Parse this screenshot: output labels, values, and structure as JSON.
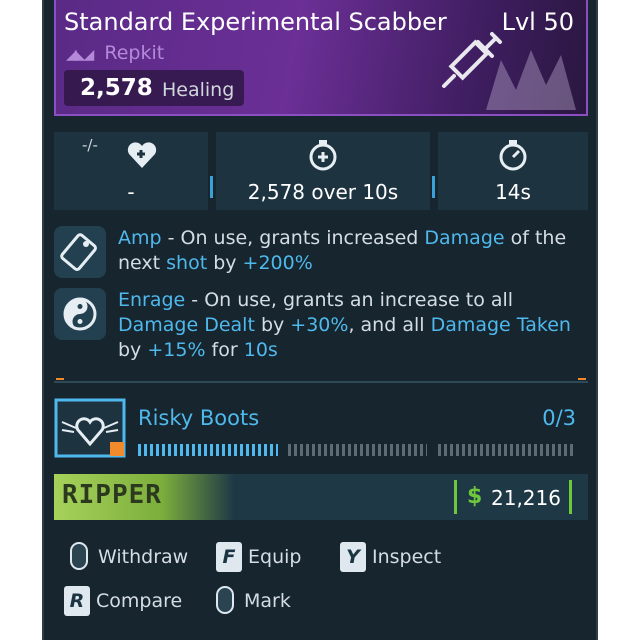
{
  "item": {
    "name": "Standard Experimental Scabber",
    "level": "Lvl 50",
    "rarity": "Repkit",
    "heal_value": "2,578",
    "heal_label": "Healing"
  },
  "stats": [
    {
      "icon": "heart-tag-icon",
      "badge": "-/-",
      "value": "-"
    },
    {
      "icon": "stopwatch-heal-icon",
      "value": "2,578 over 10s"
    },
    {
      "icon": "stopwatch-icon",
      "value": "14s"
    }
  ],
  "perks": [
    {
      "icon": "ticket-icon",
      "segments": [
        {
          "t": "Amp",
          "hl": true
        },
        {
          "t": " - On use, grants increased ",
          "hl": false
        },
        {
          "t": "Damage",
          "hl": true
        },
        {
          "t": " of the next ",
          "hl": false
        },
        {
          "t": "shot",
          "hl": true
        },
        {
          "t": " by ",
          "hl": false
        },
        {
          "t": "+200%",
          "hl": true
        }
      ]
    },
    {
      "icon": "yin-yang-icon",
      "segments": [
        {
          "t": "Enrage",
          "hl": true
        },
        {
          "t": " - On use, grants an increase to all ",
          "hl": false
        },
        {
          "t": "Damage Dealt",
          "hl": true
        },
        {
          "t": " by ",
          "hl": false
        },
        {
          "t": "+30%",
          "hl": true
        },
        {
          "t": ", and all ",
          "hl": false
        },
        {
          "t": "Damage Taken",
          "hl": true
        },
        {
          "t": " by ",
          "hl": false
        },
        {
          "t": "+15%",
          "hl": true
        },
        {
          "t": " for ",
          "hl": false
        },
        {
          "t": "10s",
          "hl": true
        }
      ]
    }
  ],
  "mod": {
    "name": "Risky Boots",
    "count": "0/3",
    "progress": 0
  },
  "manufacturer": {
    "name": "RIPPER",
    "price_symbol": "$",
    "price": "21,216"
  },
  "actions": [
    {
      "key": "",
      "type": "mouse",
      "label": "Withdraw"
    },
    {
      "key": "F",
      "type": "key",
      "label": "Equip"
    },
    {
      "key": "Y",
      "type": "key",
      "label": "Inspect"
    },
    {
      "key": "R",
      "type": "key",
      "label": "Compare"
    },
    {
      "key": "",
      "type": "mouse",
      "label": "Mark"
    }
  ],
  "colors": {
    "accent": "#4fb8ec",
    "rarity_purple": "#8a4fc0",
    "money_green": "#6ec83c",
    "panel": "#16252e"
  }
}
